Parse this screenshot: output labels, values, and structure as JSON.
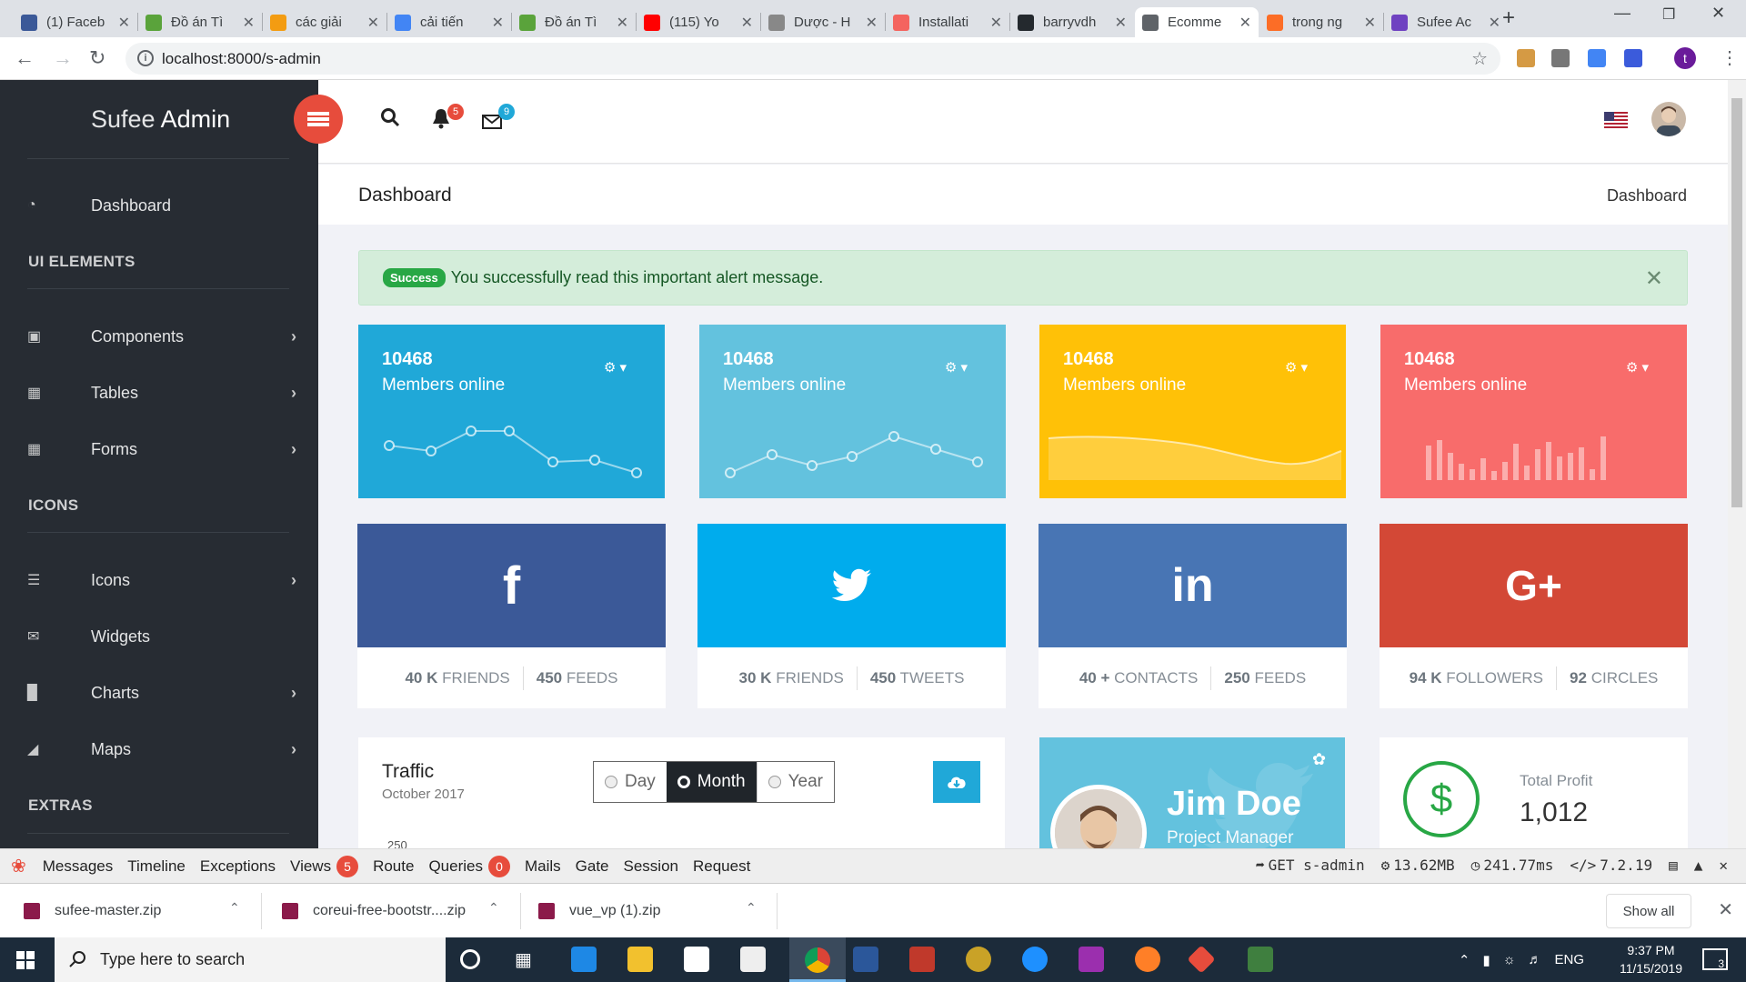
{
  "browser": {
    "tabs": [
      {
        "label": "(1) Faceb",
        "color": "#3b5998"
      },
      {
        "label": "Đồ án Tì",
        "color": "#5aa33b"
      },
      {
        "label": "các giải",
        "color": "#f39c12"
      },
      {
        "label": "cải tiến",
        "color": "#4285f4"
      },
      {
        "label": "Đồ án Tì",
        "color": "#5aa33b"
      },
      {
        "label": "(115) Yo",
        "color": "#ff0000"
      },
      {
        "label": "Dược - H",
        "color": "#888888"
      },
      {
        "label": "Installati",
        "color": "#f4645f"
      },
      {
        "label": "barryvdh",
        "color": "#24292e"
      },
      {
        "label": "Ecomme",
        "color": "#5f6368"
      },
      {
        "label": "trong ng",
        "color": "#fc6d26"
      },
      {
        "label": "Sufee Ac",
        "color": "#6f42c1"
      }
    ],
    "url": "localhost:8000/s-admin",
    "profile_initial": "t"
  },
  "sidebar": {
    "brand": "Sufee",
    "brand_strong": "Admin",
    "dashboard": "Dashboard",
    "section_ui": "UI ELEMENTS",
    "components": "Components",
    "tables": "Tables",
    "forms": "Forms",
    "section_icons": "ICONS",
    "icons": "Icons",
    "widgets": "Widgets",
    "charts": "Charts",
    "maps": "Maps",
    "section_extras": "EXTRAS"
  },
  "header": {
    "notif_count": "5",
    "mail_count": "9"
  },
  "breadcrumb": {
    "title": "Dashboard",
    "current": "Dashboard"
  },
  "alert": {
    "badge": "Success",
    "message": "You successfully read this important alert message."
  },
  "stats": [
    {
      "number": "10468",
      "label": "Members online",
      "color": "#20a8d8"
    },
    {
      "number": "10468",
      "label": "Members online",
      "color": "#63c2de"
    },
    {
      "number": "10468",
      "label": "Members online",
      "color": "#ffc107"
    },
    {
      "number": "10468",
      "label": "Members online",
      "color": "#f86c6b"
    }
  ],
  "social": [
    {
      "icon": "f",
      "color": "#3b5998",
      "a_num": "40 k",
      "a_lbl": "FRIENDS",
      "b_num": "450",
      "b_lbl": "FEEDS"
    },
    {
      "icon": "twitter",
      "color": "#00aced",
      "a_num": "30 k",
      "a_lbl": "FRIENDS",
      "b_num": "450",
      "b_lbl": "TWEETS"
    },
    {
      "icon": "in",
      "color": "#4875b4",
      "a_num": "40 +",
      "a_lbl": "CONTACTS",
      "b_num": "250",
      "b_lbl": "FEEDS"
    },
    {
      "icon": "G+",
      "color": "#d34836",
      "a_num": "94 k",
      "a_lbl": "FOLLOWERS",
      "b_num": "92",
      "b_lbl": "CIRCLES"
    }
  ],
  "traffic": {
    "title": "Traffic",
    "subtitle": "October 2017",
    "options": [
      "Day",
      "Month",
      "Year"
    ],
    "selected": "Month",
    "y_tick": "250"
  },
  "profile_card": {
    "name": "Jim Doe",
    "role": "Project Manager"
  },
  "profit": {
    "label": "Total Profit",
    "value": "1,012"
  },
  "debugbar": {
    "items": [
      "Messages",
      "Timeline",
      "Exceptions",
      "Views",
      "Route",
      "Queries",
      "Mails",
      "Gate",
      "Session",
      "Request"
    ],
    "views_count": "5",
    "queries_count": "0",
    "route": "GET s-admin",
    "memory": "13.62MB",
    "time": "241.77ms",
    "version": "7.2.19"
  },
  "downloads": [
    {
      "name": "sufee-master.zip"
    },
    {
      "name": "coreui-free-bootstr....zip"
    },
    {
      "name": "vue_vp (1).zip"
    }
  ],
  "downloads_show_all": "Show all",
  "taskbar": {
    "search_placeholder": "Type here to search",
    "lang": "ENG",
    "time": "9:37 PM",
    "date": "11/15/2019",
    "notif": "3"
  }
}
